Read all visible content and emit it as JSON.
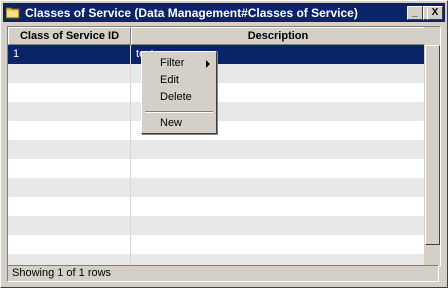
{
  "window": {
    "title": "Classes of Service (Data Management#Classes of Service)",
    "minimize": "_",
    "maximize": "□",
    "close": "X"
  },
  "grid": {
    "columns": [
      "Class of Service ID",
      "Description"
    ],
    "rows": [
      {
        "id": "1",
        "description": "test",
        "selected": true
      }
    ],
    "empty_rows": 11
  },
  "context_menu": {
    "filter": "Filter",
    "edit": "Edit",
    "delete": "Delete",
    "new": "New"
  },
  "status": {
    "text": "Showing 1 of 1 rows"
  },
  "colors": {
    "title_bar": "#0a246a",
    "selection": "#0a246a",
    "face": "#d4d0c8"
  }
}
